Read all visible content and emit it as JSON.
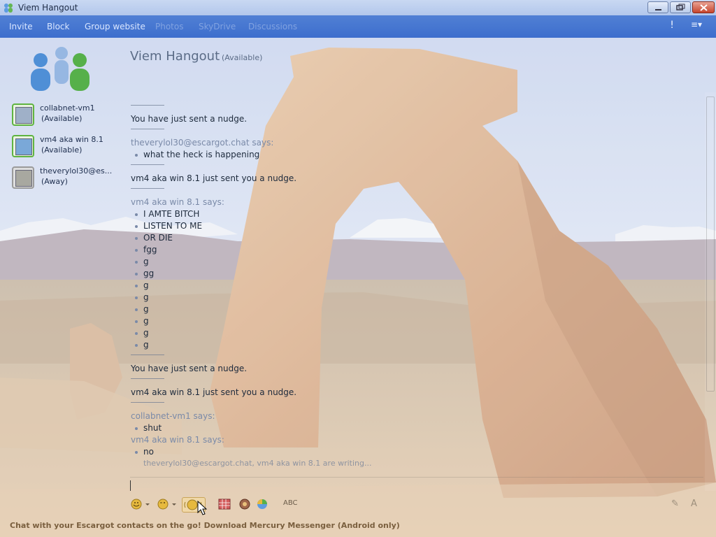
{
  "window": {
    "title": "Viem Hangout"
  },
  "toolbar": {
    "items": [
      "Invite",
      "Block",
      "Group website",
      "Photos",
      "SkyDrive",
      "Discussions"
    ],
    "alert_label": "!",
    "menu_label": "≡▾"
  },
  "sidebar": {
    "contacts": [
      {
        "name": "collabnet-vm1",
        "status": "(Available)"
      },
      {
        "name": "vm4 aka win 8.1",
        "status": "(Available)"
      },
      {
        "name": "theverylol30@es...",
        "status": "(Away)"
      }
    ]
  },
  "conversation": {
    "title": "Viem Hangout",
    "status": "(Available)"
  },
  "chat": {
    "nudge_sent": "You have just sent a nudge.",
    "nudge_received": "vm4 aka win 8.1 just sent you a nudge.",
    "says_theverylol": "theverylol30@escargot.chat says:",
    "msg_theverylol": "what the heck is happening",
    "says_vm4": "vm4 aka win 8.1 says:",
    "vm4_messages": [
      "I AMTE BITCH",
      "LISTEN TO ME",
      "OR DIE",
      "fgg",
      "g",
      "gg",
      "g",
      "g",
      "g",
      "g",
      "g",
      "g"
    ],
    "says_collab": "collabnet-vm1 says:",
    "msg_collab": "shut",
    "says_vm4_2": "vm4 aka win 8.1 says:",
    "msg_vm4_2": "no",
    "typing": "theverylol30@escargot.chat, vm4 aka win 8.1 are writing..."
  },
  "footer": {
    "text": "Chat with your Escargot contacts on the go! Download Mercury Messenger (Android only)"
  },
  "format_bar": {
    "font_label": "A",
    "spell_label": "ABC"
  }
}
